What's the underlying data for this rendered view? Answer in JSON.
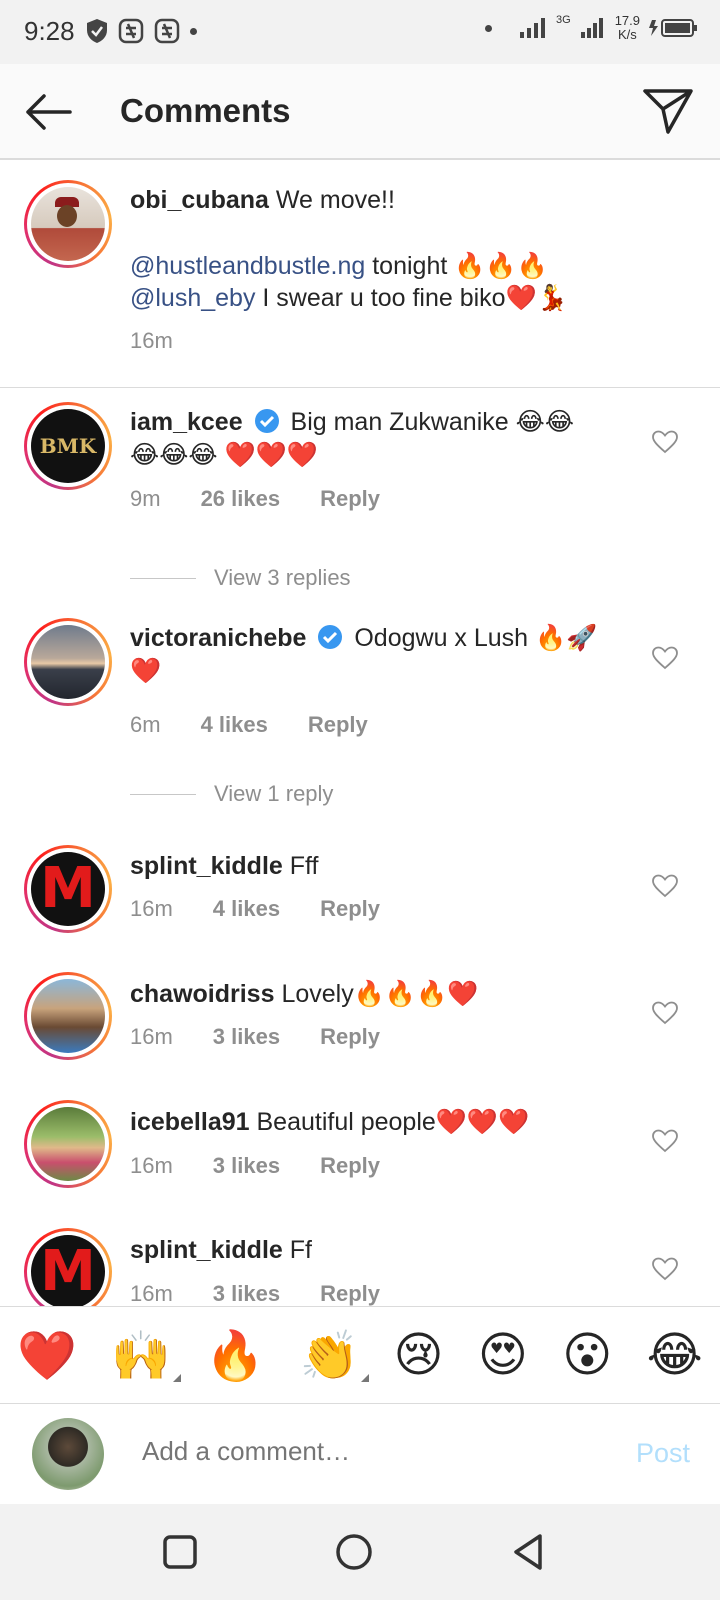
{
  "status_bar": {
    "time": "9:28",
    "network": "3G",
    "speed_value": "17.9",
    "speed_unit": "K/s"
  },
  "header": {
    "title": "Comments"
  },
  "caption": {
    "username": "obi_cubana",
    "line1": "We move!!",
    "mention1": "@hustleandbustle.ng",
    "mention1_after": " tonight 🔥🔥🔥",
    "mention2": "@lush_eby",
    "mention2_after": " I swear u too fine biko❤️💃",
    "time": "16m"
  },
  "comments": [
    {
      "username": "iam_kcee",
      "verified": true,
      "text": "Big man Zukwanike 😂😂",
      "text2": "😂😂😂 ❤️❤️❤️",
      "time": "9m",
      "likes": "26 likes",
      "reply": "Reply",
      "view_replies": "View 3 replies"
    },
    {
      "username": "victoranichebe",
      "verified": true,
      "text": "Odogwu x Lush 🔥🚀",
      "text2": "❤️",
      "time": "6m",
      "likes": "4 likes",
      "reply": "Reply",
      "view_replies": "View 1 reply"
    },
    {
      "username": "splint_kiddle",
      "verified": false,
      "text": "Fff",
      "time": "16m",
      "likes": "4 likes",
      "reply": "Reply"
    },
    {
      "username": "chawoidriss",
      "verified": false,
      "text": "Lovely🔥🔥🔥❤️",
      "time": "16m",
      "likes": "3 likes",
      "reply": "Reply"
    },
    {
      "username": "icebella91",
      "verified": false,
      "text": "Beautiful people❤️❤️❤️",
      "time": "16m",
      "likes": "3 likes",
      "reply": "Reply"
    },
    {
      "username": "splint_kiddle",
      "verified": false,
      "text": "Ff",
      "time": "16m",
      "likes": "3 likes",
      "reply": "Reply"
    }
  ],
  "emoji_bar": [
    "❤️",
    "🙌",
    "🔥",
    "👏",
    "😢",
    "😍",
    "😮",
    "😂"
  ],
  "add_comment": {
    "placeholder": "Add a comment…",
    "post_label": "Post"
  },
  "colors": {
    "mention": "#385185",
    "post_disabled": "#b2dffc",
    "verified": "#3897f0"
  }
}
